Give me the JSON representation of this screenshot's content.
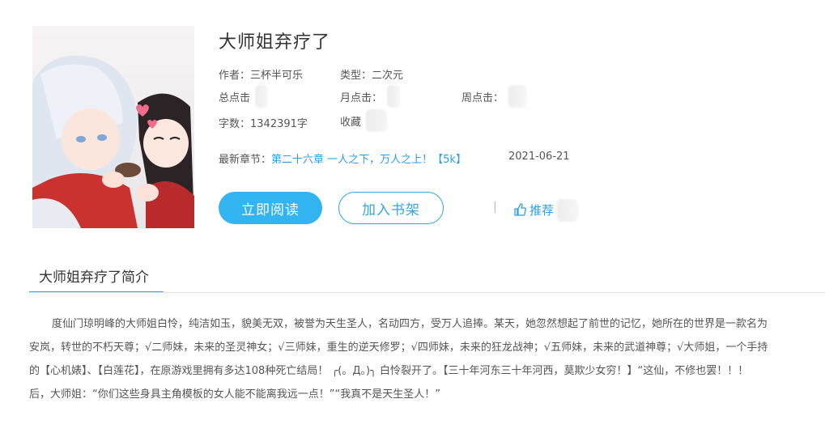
{
  "book": {
    "title": "大师姐弃疗了",
    "author_label": "作者：",
    "author": "三杯半可乐",
    "type_label": "类型：",
    "type": "二次元",
    "total_clicks_label": "总点击",
    "monthly_clicks_label": "月点击：",
    "weekly_clicks_label": "周点击：",
    "word_count_label": "字数：",
    "word_count": "1342391字",
    "collection_label": "收藏"
  },
  "latest": {
    "label": "最新章节：",
    "chapter": "第二十六章 一人之下，万人之上！【5k】",
    "date": "2021-06-21"
  },
  "actions": {
    "read": "立即阅读",
    "add_shelf": "加入书架",
    "separator": "|",
    "recommend": "推荐"
  },
  "intro": {
    "tab_label": "大师姐弃疗了简介",
    "lines": [
      "度仙门琼明峰的大师姐白怜，纯洁如玉，貌美无双，被誉为天生圣人，名动四方，受万人追捧。某天，她忽然想起了前世的记忆，她所在的世界是一款名为",
      "安岚，转世的不朽天尊；√二师妹，未来的圣灵神女；√三师妹，重生的逆天修罗；√四师妹，未来的狂龙战神；√五师妹，未来的武道神尊；√大师姐，一个手持",
      "的【心机婊】、【白莲花】，在原游戏里拥有多达108种死亡结局！ ╭(。Д。)╮ 白怜裂开了。【三十年河东三十年河西，莫欺少女穷！】“这仙，不修也罢！！！",
      "后，大师姐：“你们这些身具主角模板的女人能不能离我远一点！”“我真不是天生圣人！”"
    ]
  },
  "colors": {
    "accent": "#32b4f1",
    "link": "#2a9fe8"
  }
}
